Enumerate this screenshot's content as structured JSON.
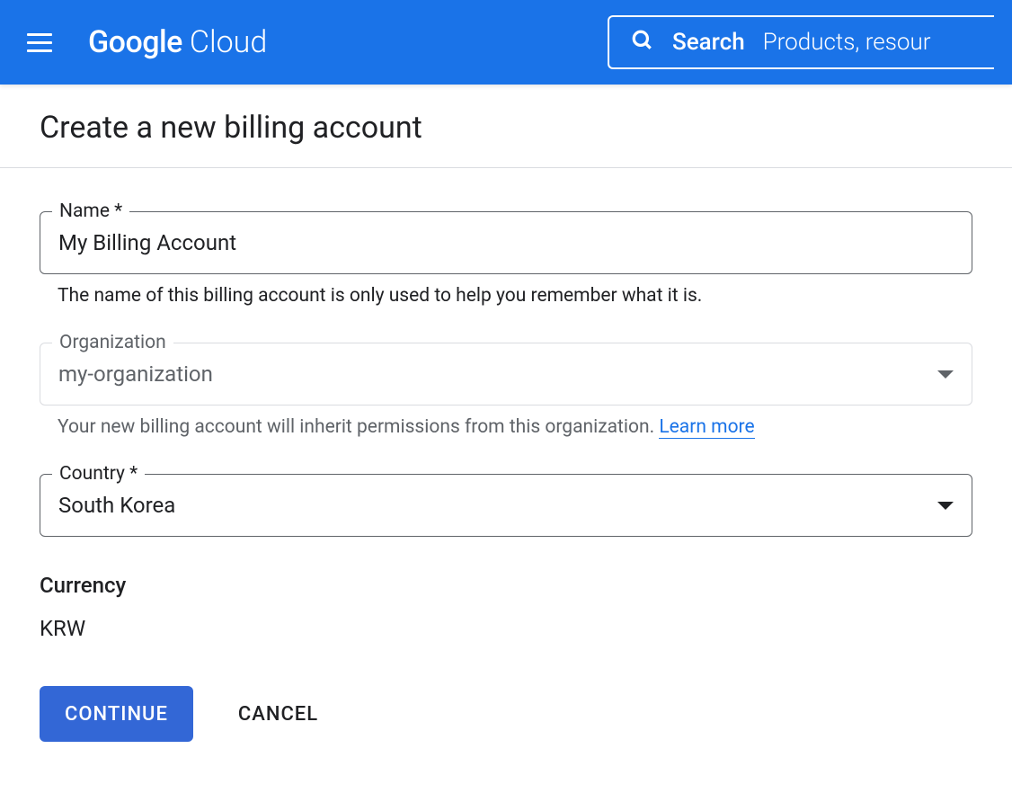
{
  "header": {
    "logo_google": "Google",
    "logo_cloud": "Cloud",
    "search_label": "Search",
    "search_placeholder": "Products, resour"
  },
  "page": {
    "title": "Create a new billing account"
  },
  "form": {
    "name": {
      "label": "Name *",
      "value": "My Billing Account",
      "helper": "The name of this billing account is only used to help you remember what it is."
    },
    "organization": {
      "label": "Organization",
      "value": "my-organization",
      "helper_prefix": "Your new billing account will inherit permissions from this organization. ",
      "helper_link": "Learn more"
    },
    "country": {
      "label": "Country *",
      "value": "South Korea"
    },
    "currency": {
      "label": "Currency",
      "value": "KRW"
    },
    "buttons": {
      "continue": "CONTINUE",
      "cancel": "CANCEL"
    }
  }
}
